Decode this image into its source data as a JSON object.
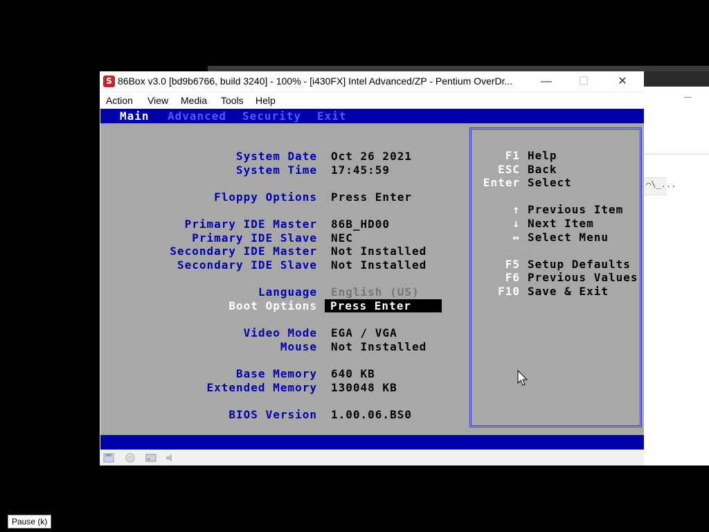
{
  "window": {
    "title": "86Box v3.0 [bd9b6766, build 3240] - 100% - [i430FX] Intel Advanced/ZP - Pentium OverDr...",
    "icon_letter": "S",
    "minimize": "—",
    "maximize": "☐",
    "close": "✕"
  },
  "menu": [
    "Action",
    "View",
    "Media",
    "Tools",
    "Help"
  ],
  "bios": {
    "tabs": [
      "Main",
      "Advanced",
      "Security",
      "Exit"
    ],
    "fields": [
      {
        "label": "System Date",
        "value": "Oct 26 2021"
      },
      {
        "label": "System Time",
        "value": "17:45:59"
      },
      {
        "label": "Floppy Options",
        "value": "Press Enter"
      },
      {
        "label": "Primary IDE Master",
        "value": "86B_HD00"
      },
      {
        "label": "Primary IDE Slave",
        "value": "NEC"
      },
      {
        "label": "Secondary IDE Master",
        "value": "Not Installed"
      },
      {
        "label": "Secondary IDE Slave",
        "value": "Not Installed"
      },
      {
        "label": "Language",
        "value": "English  (US)"
      },
      {
        "label": "Boot Options",
        "value": "Press Enter"
      },
      {
        "label": "Video Mode",
        "value": "EGA / VGA"
      },
      {
        "label": "Mouse",
        "value": "Not Installed"
      },
      {
        "label": "Base Memory",
        "value": "640 KB"
      },
      {
        "label": "Extended Memory",
        "value": "130048 KB"
      },
      {
        "label": "BIOS Version",
        "value": "1.00.06.BS0"
      }
    ],
    "help": [
      {
        "key": "F1",
        "desc": "Help"
      },
      {
        "key": "ESC",
        "desc": "Back"
      },
      {
        "key": "Enter",
        "desc": "Select"
      },
      {
        "key": "↑",
        "desc": "Previous Item"
      },
      {
        "key": "↓",
        "desc": "Next Item"
      },
      {
        "key": "↔",
        "desc": "Select Menu"
      },
      {
        "key": "F5",
        "desc": "Setup Defaults"
      },
      {
        "key": "F6",
        "desc": "Previous Values"
      },
      {
        "key": "F10",
        "desc": "Save & Exit"
      }
    ]
  },
  "statusbar_icons": [
    "floppy-icon",
    "cdrom-icon",
    "hdd-icon",
    "sound-icon"
  ],
  "tooltip": "Pause (k)",
  "background_panel_text": "⌒\\_..."
}
